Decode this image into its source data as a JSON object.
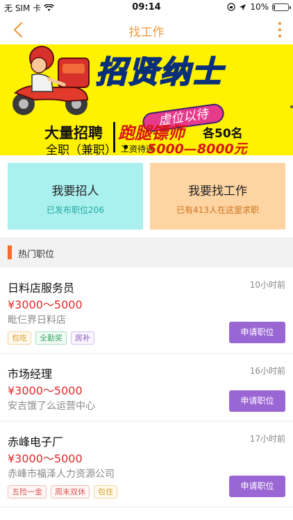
{
  "status_bar": {
    "carrier": "无 SIM 卡",
    "time": "09:14",
    "battery_text": "10%",
    "battery_level": 0.1
  },
  "nav": {
    "title": "找工作",
    "back_icon": "chevron-left-icon",
    "more_icon": "more-vertical-icon",
    "accent_color": "#f0993c"
  },
  "banner": {
    "headline": "招贤纳士",
    "badge": "虚位以待",
    "recruit_text": "大量招聘",
    "job_type": "全职（兼职）",
    "job_name": "跑腿镖师",
    "count_text": "各50名",
    "salary_label": "工资待遇",
    "salary_value": "5000—8000元"
  },
  "actions": {
    "hire": {
      "title": "我要招人",
      "subtitle": "已发布职位206"
    },
    "find": {
      "title": "我要找工作",
      "subtitle": "已有413人在这里求职"
    }
  },
  "section": {
    "title": "热门职位"
  },
  "jobs": [
    {
      "title": "日料店服务员",
      "time": "10小时前",
      "salary": "¥3000～5000",
      "company": "毗仨界日料店",
      "tags": [
        "包吃",
        "全勤奖",
        "房补"
      ],
      "apply_label": "申请职位"
    },
    {
      "title": "市场经理",
      "time": "16小时前",
      "salary": "¥3000～5000",
      "company": "安吉饿了么运营中心",
      "tags": [],
      "apply_label": "申请职位"
    },
    {
      "title": "赤峰电子厂",
      "time": "17小时前",
      "salary": "¥3000～5000",
      "company": "赤峰市福泽人力资源公司",
      "tags": [
        "五险一金",
        "周末双休",
        "包住"
      ],
      "apply_label": "申请职位"
    }
  ]
}
